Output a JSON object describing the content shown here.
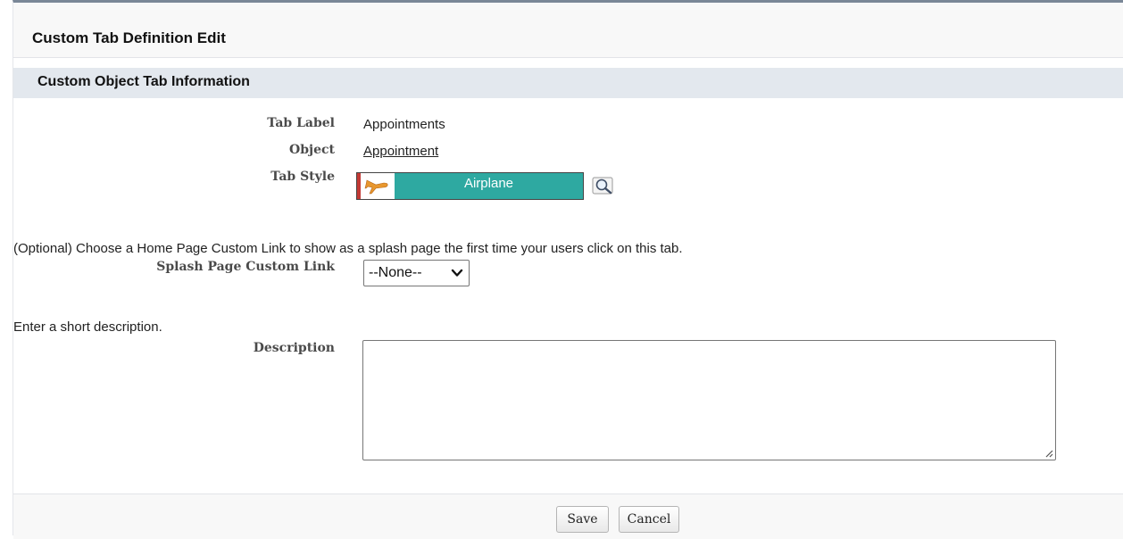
{
  "page": {
    "title": "Custom Tab Definition Edit"
  },
  "section": {
    "title": "Custom Object Tab Information"
  },
  "fields": {
    "tab_label": {
      "label": "Tab Label",
      "value": "Appointments"
    },
    "object": {
      "label": "Object",
      "value": "Appointment"
    },
    "tab_style": {
      "label": "Tab Style",
      "value": "Airplane",
      "icon": "airplane-icon",
      "color": "#2ea9a1",
      "accent": "#c23934"
    }
  },
  "splash": {
    "hint": "(Optional) Choose a Home Page Custom Link to show as a splash page the first time your users click on this tab.",
    "label": "Splash Page Custom Link",
    "selected": "--None--"
  },
  "description": {
    "hint": "Enter a short description.",
    "label": "Description",
    "value": ""
  },
  "buttons": {
    "save": "Save",
    "cancel": "Cancel"
  }
}
